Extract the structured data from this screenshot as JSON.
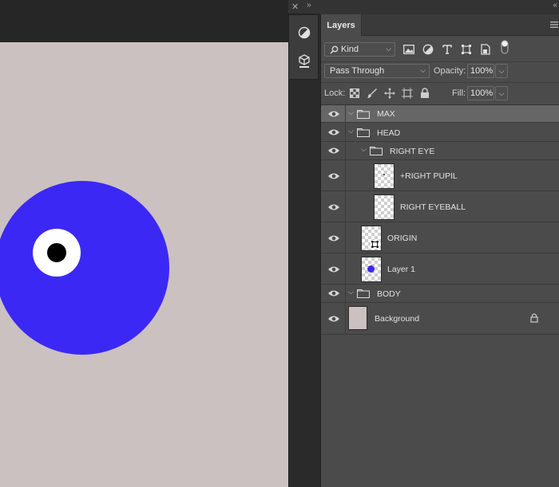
{
  "panel": {
    "tab_label": "Layers",
    "filter": {
      "label": "Kind"
    },
    "blend_mode": {
      "value": "Pass Through"
    },
    "opacity": {
      "label": "Opacity:",
      "value": "100%"
    },
    "lock": {
      "label": "Lock:"
    },
    "fill": {
      "label": "Fill:",
      "value": "100%"
    }
  },
  "layers": [
    {
      "name": "MAX",
      "kind": "group",
      "selected": true
    },
    {
      "name": "HEAD",
      "kind": "group"
    },
    {
      "name": "RIGHT EYE",
      "kind": "group"
    },
    {
      "name": "+RIGHT PUPIL",
      "kind": "layer"
    },
    {
      "name": "RIGHT EYEBALL",
      "kind": "layer"
    },
    {
      "name": "ORIGIN",
      "kind": "layer"
    },
    {
      "name": "Layer 1",
      "kind": "layer"
    },
    {
      "name": "BODY",
      "kind": "group"
    },
    {
      "name": "Background",
      "kind": "layer",
      "locked": true
    }
  ],
  "colors": {
    "canvas_bg": "#cbc1c1",
    "head_blue": "#3c28f5",
    "eyeball": "#ffffff",
    "pupil": "#000000",
    "panel_bg": "#4b4b4b",
    "selected_row": "#666666"
  }
}
